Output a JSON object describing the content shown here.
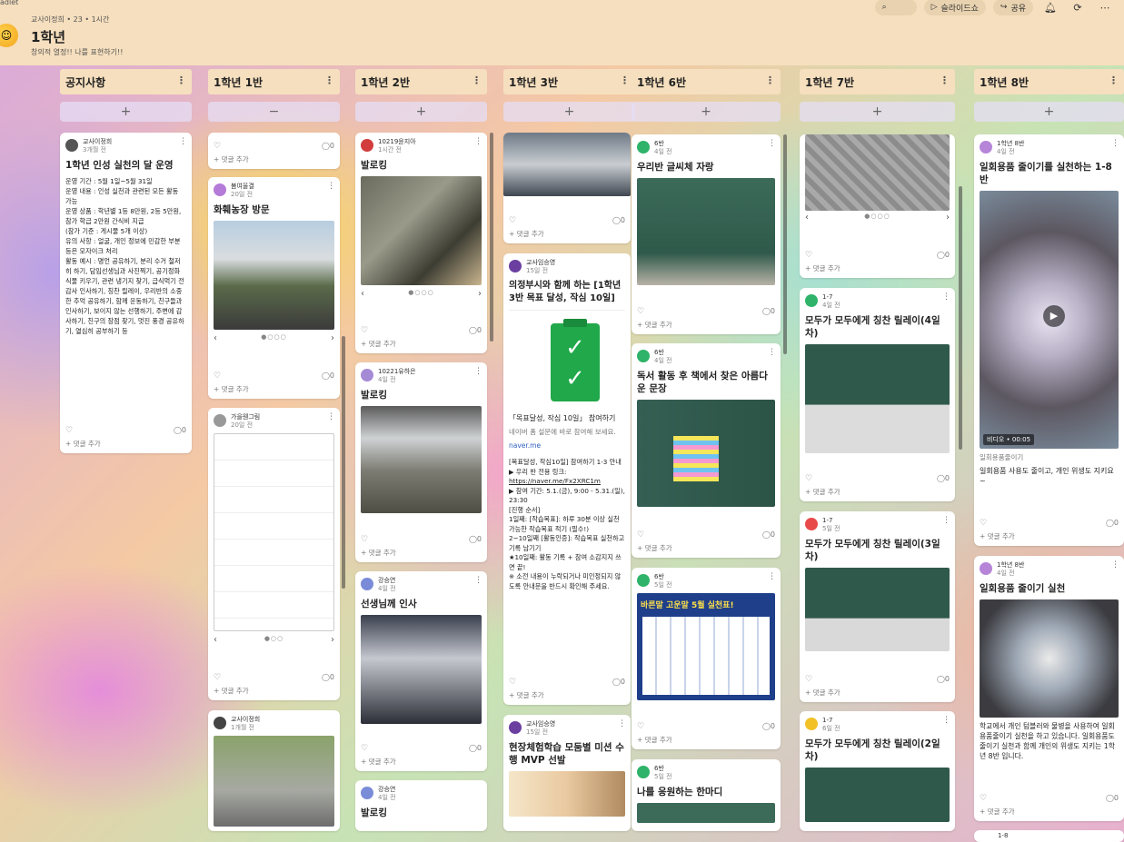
{
  "header": {
    "logo_text": "adlet",
    "breadcrumb": "교사이정희 • 23 • 1시간",
    "title": "1학년",
    "subtitle": "창의적 열정!! 나를 표현하기!!",
    "actions": {
      "search_icon": "search-icon",
      "slideshow": "슬라이드쇼",
      "share": "공유"
    }
  },
  "columns": [
    {
      "title": "공지사항"
    },
    {
      "title": "1학년 1반"
    },
    {
      "title": "1학년 2반"
    },
    {
      "title": "1학년 3반"
    },
    {
      "title": "1학년 6반"
    },
    {
      "title": "1학년 7반"
    },
    {
      "title": "1학년 8반"
    }
  ],
  "col_menu": "⋮",
  "add_plus": "+",
  "add_minus": "−",
  "footer": {
    "add_comment": "+ 댓글 추가"
  },
  "notice": {
    "author": "교사이정희",
    "time": "3개월 전",
    "title": "1학년 인성 실천의 달 운영",
    "body": [
      "운영 기간 : 5월 1일~5월 31일",
      "운영 내용 : 인성 실천과 관련된 모든 활동 가능",
      "운영 상품 : 학년별 1등 8만원, 2등 5만원, 참가 학급 2만원 간식비 지급",
      "(참가 기준 : 게시물 5개 이상)",
      "유의 사항 : 얼굴, 개인 정보에 민감한 부분 등은 모자이크 처리",
      "활동 예시 : 명언 공유하기, 분리 수거 철저히 하기, 담임선생님과 사진찍기, 공기정화 식물 키우기, 관련 냉기지 찾기, 급식먹기 전 감사 인사하기, 칭찬 릴레이, 우리반의 소중한 추억 공유하기, 함께 운동하기, 친구들과 인사하기, 보이지 않는 선행하기, 주변에 감사하기, 친구의 장점 찾기, 멋진 풍경 공유하기, 열심히 공부하기 등"
    ]
  },
  "c1": [
    {
      "author": "",
      "time": "",
      "title": ""
    },
    {
      "author": "봄여울결",
      "time": "20일 전",
      "title": "화훼농장 방문"
    },
    {
      "author": "가을웬그림",
      "time": "20일 전",
      "title": ""
    },
    {
      "author": "교사이정희",
      "time": "1개월 전",
      "title": ""
    }
  ],
  "c2": [
    {
      "author": "10219윤지아",
      "time": "1시간 전",
      "title": "발로킹"
    },
    {
      "author": "10221유하은",
      "time": "4일 전",
      "title": "발로킹"
    },
    {
      "author": "강승연",
      "time": "4일 전",
      "title": "선생님께 인사"
    },
    {
      "author": "강승연",
      "time": "4일 전",
      "title": "발로킹"
    }
  ],
  "c3": [
    {
      "author": "교사임승영",
      "time": "15일 전",
      "title": "의정부시와 함께 하는 [1학년 3반 목표 달성, 작심 10일]",
      "link_title": "「목표달성, 작심 10일」 참여하기",
      "link_desc": "네이버 폼 설문에 바로 참여해 보세요.",
      "link_host": "naver.me",
      "body": [
        "[목표달성, 작심10일] 참여하기 1-3 안내",
        "▶ 우리 반 전용 링크:",
        "https://naver.me/Fx2XRC1m",
        "▶ 참여 기간: 5.1.(금), 9:00 - 5.31.(일), 23:30",
        "[진행 순서]",
        "1일째: [작습목표]: 하루 30분 이상 실천 가능한 작습목표 적기 (필수!)",
        "2~10일째 [활동인증]: 작습목표 실천하고 기록 남기기",
        "★10일째: 활동 기록 + 참여 소감지지 쓰면 끝!",
        "※ 소전 내용이 누락되거나 미인정되지 않도록 안내문을 반드시 확인해 주세요."
      ]
    },
    {
      "author": "교사임승영",
      "time": "15일 전",
      "title": "현장체험학습 모둠별 미션 수행 MVP 선발"
    }
  ],
  "c6": [
    {
      "author": "6반",
      "time": "4일 전",
      "title": "우리반 글씨체 자랑"
    },
    {
      "author": "6반",
      "time": "4일 전",
      "title": "독서 활동 후 책에서 찾은 아름다운 문장"
    },
    {
      "author": "6반",
      "time": "5일 전",
      "title": "",
      "poster": "바른말 고운말 5월 실천표!"
    },
    {
      "author": "6반",
      "time": "5일 전",
      "title": "나를 응원하는 한마디"
    }
  ],
  "c7": [
    {
      "author": "1-7",
      "time": "4일 전",
      "title": "모두가 모두에게 칭찬 릴레이(4일차)"
    },
    {
      "author": "1-7",
      "time": "5일 전",
      "title": "모두가 모두에게 칭찬 릴레이(3일차)"
    },
    {
      "author": "1-7",
      "time": "6일 전",
      "title": "모두가 모두에게 칭찬 릴레이(2일차)"
    }
  ],
  "c8": [
    {
      "author": "1학년 8반",
      "time": "4일 전",
      "title": "일회용품 줄이기를 실천하는 1-8반",
      "video": "비디오 • 00:05",
      "caption": "일회용품줄이기",
      "body": "일회용품 사용도 줄이고, 개인 위생도 지키요~"
    },
    {
      "author": "1학년 8반",
      "time": "4일 전",
      "title": "일회용품 줄이기 실천",
      "body": "학교에서 개인 텀블러와 물병을 사용하여 일회용품줄이기 실천을 하고 있습니다. 일회용품도 줄이기 실천과 함께 개인의 위생도 지키는 1학년 8반 입니다."
    },
    {
      "author": "1-8",
      "time": "",
      "title": ""
    }
  ]
}
